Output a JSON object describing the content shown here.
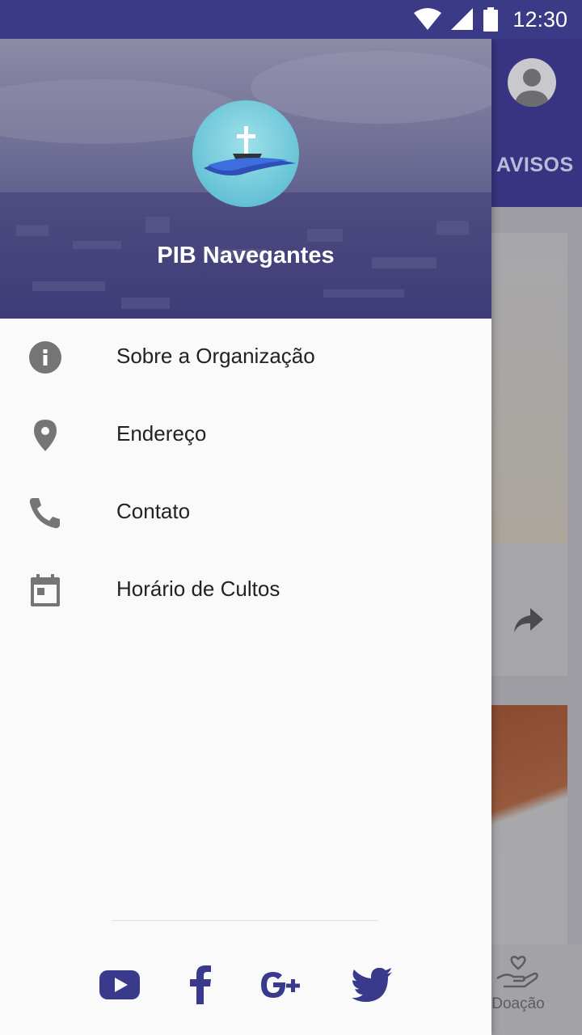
{
  "status_bar": {
    "time": "12:30"
  },
  "app": {
    "tab_label": "AVISOS",
    "bottom_nav_doacao": "Doação"
  },
  "drawer": {
    "title": "PIB Navegantes",
    "items": [
      {
        "label": "Sobre a Organização",
        "icon": "info-icon"
      },
      {
        "label": "Endereço",
        "icon": "location-pin-icon"
      },
      {
        "label": "Contato",
        "icon": "phone-icon"
      },
      {
        "label": "Horário de Cultos",
        "icon": "calendar-icon"
      }
    ],
    "social": [
      "youtube-icon",
      "facebook-icon",
      "google-plus-icon",
      "twitter-icon"
    ]
  },
  "colors": {
    "primary": "#3a3a86",
    "social": "#3a3a8c",
    "menu_icon": "#757575"
  }
}
